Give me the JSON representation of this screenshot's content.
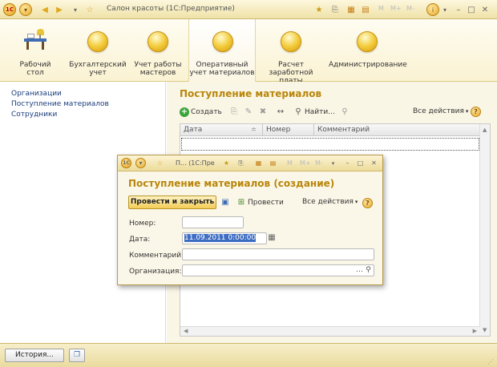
{
  "window": {
    "title": "Салон красоты  (1С:Предприятие)",
    "logo": "1С",
    "mbuttons": [
      "M",
      "M+",
      "M-"
    ]
  },
  "sections": [
    {
      "label": "Рабочий\nстол",
      "icon": "desk-icon"
    },
    {
      "label": "Бухгалтерский\nучет",
      "icon": "section-icon"
    },
    {
      "label": "Учет работы\nмастеров",
      "icon": "section-icon"
    },
    {
      "label": "Оперативный\nучет материалов",
      "icon": "section-icon"
    },
    {
      "label": "Расчет\nзаработной платы",
      "icon": "section-icon"
    },
    {
      "label": "Администрирование",
      "icon": "section-icon"
    }
  ],
  "nav": {
    "items": [
      "Организации",
      "Поступление материалов",
      "Сотрудники"
    ]
  },
  "list": {
    "title": "Поступление материалов",
    "create_label": "Создать",
    "find_label": "Найти...",
    "all_actions_label": "Все действия",
    "columns": [
      "Дата",
      "Номер",
      "Комментарий"
    ]
  },
  "status": {
    "history_label": "История..."
  },
  "dialog": {
    "title": "П...  (1С:Пре",
    "heading": "Поступление материалов (создание)",
    "post_close_label": "Провести и закрыть",
    "post_label": "Провести",
    "all_actions_label": "Все действия",
    "fields": {
      "number_label": "Номер:",
      "number_value": "",
      "date_label": "Дата:",
      "date_value": "11.09.2011  0:00:00",
      "comment_label": "Комментарий:",
      "comment_value": "",
      "org_label": "Организация:",
      "org_value": ""
    },
    "mbuttons": [
      "M",
      "M+",
      "M-"
    ]
  },
  "colors": {
    "accent_title": "#b8860b",
    "nav_link": "#1a3d7c",
    "selection": "#3d6cc3",
    "panel_bg": "#faf6e6"
  }
}
